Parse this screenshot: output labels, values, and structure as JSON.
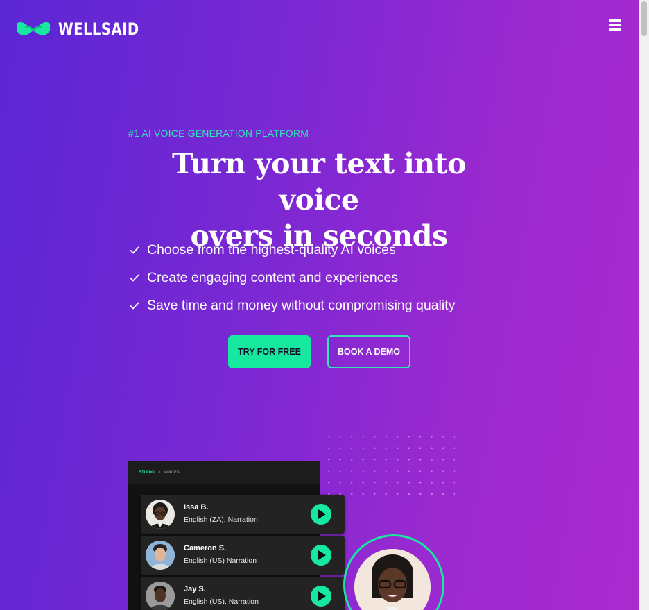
{
  "brand": {
    "name": "WELLSAID",
    "accent": "#17e8a0"
  },
  "header": {
    "menu_icon": "hamburger-menu-icon"
  },
  "hero": {
    "eyebrow": "#1 AI VOICE GENERATION PLATFORM",
    "headline_line1": "Turn your text into voice",
    "headline_line2": "overs in seconds",
    "features": [
      "Choose from the highest-quality AI voices",
      "Create engaging content and experiences",
      "Save time and money without compromising quality"
    ],
    "primary_cta": "TRY FOR FREE",
    "secondary_cta": "BOOK A DEMO"
  },
  "studio": {
    "breadcrumb_root": "STUDIO",
    "breadcrumb_sep": ">",
    "breadcrumb_current": "VOICES",
    "voices": [
      {
        "name": "Issa B.",
        "desc": "English (ZA), Narration"
      },
      {
        "name": "Cameron S.",
        "desc": "English (US) Narration"
      },
      {
        "name": "Jay S.",
        "desc": "English (US), Narration"
      }
    ]
  }
}
